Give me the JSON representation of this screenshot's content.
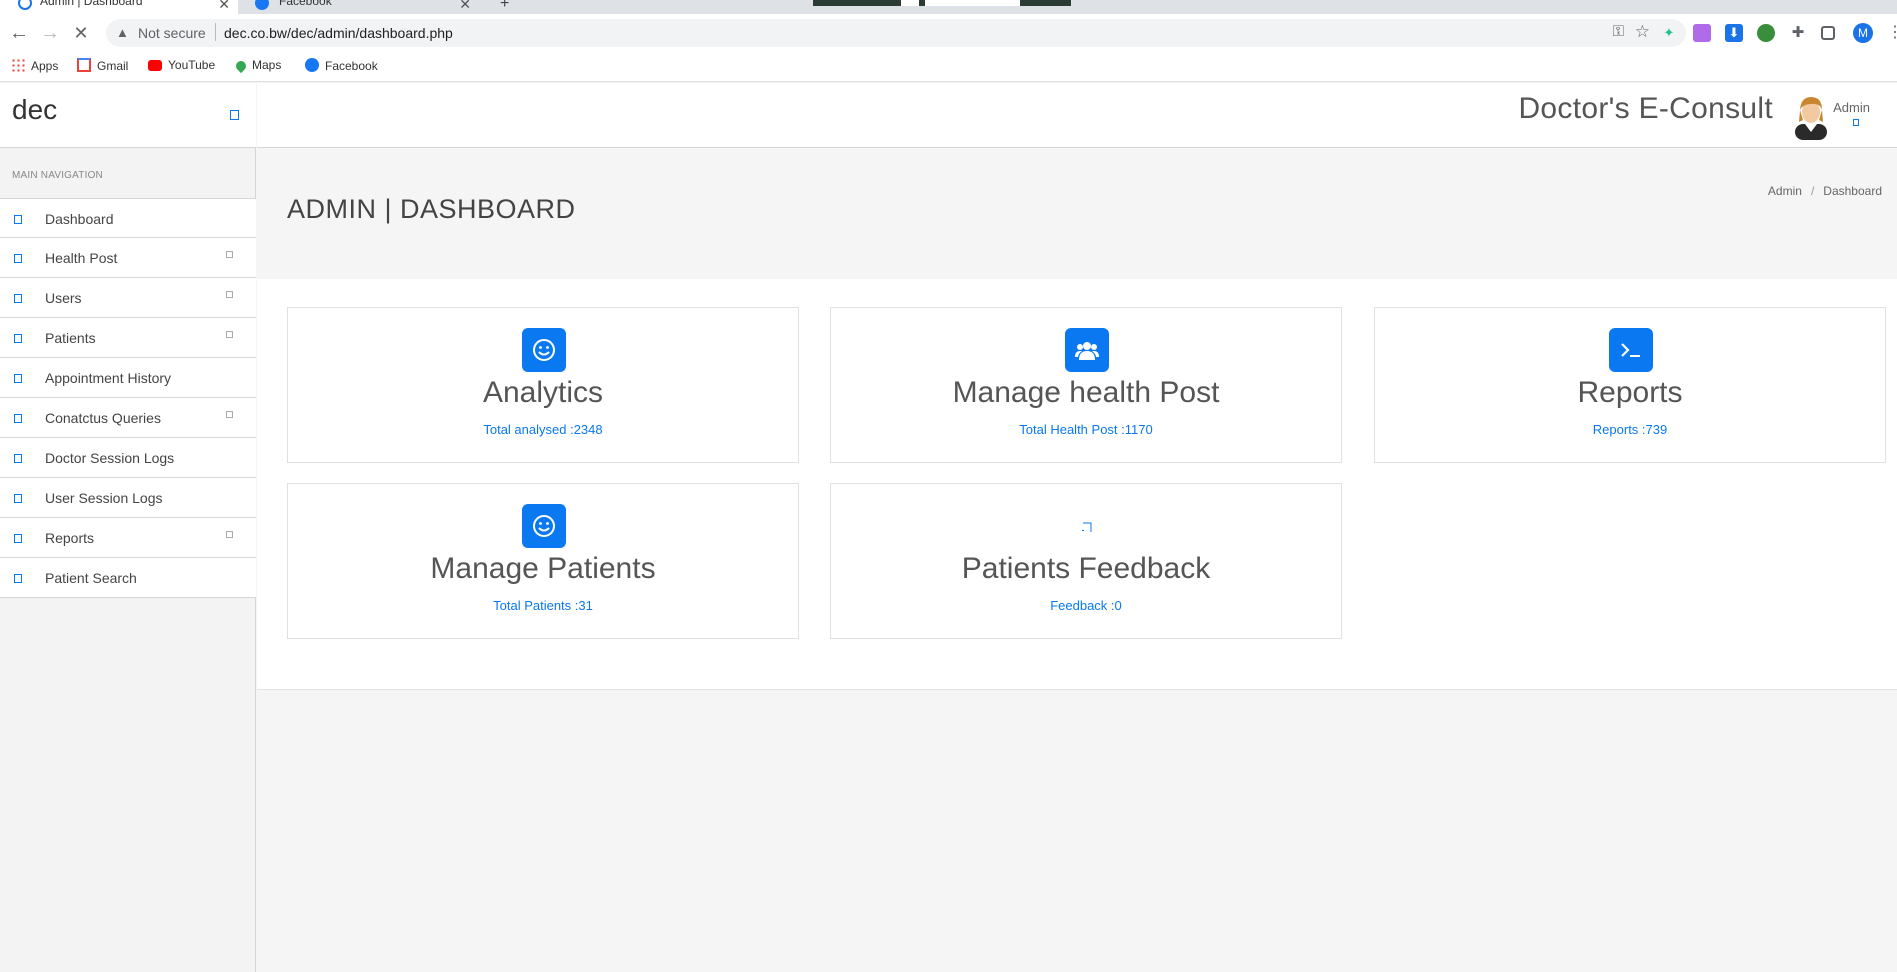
{
  "browser": {
    "tabs": [
      {
        "label": "Admin | Dashboard",
        "active": true
      },
      {
        "label": "Facebook",
        "active": false
      }
    ],
    "address": {
      "security_label": "Not secure",
      "url": "dec.co.bw/dec/admin/dashboard.php"
    },
    "bookmarks": [
      {
        "label": "Apps",
        "icon": "apps-grid-icon"
      },
      {
        "label": "Gmail",
        "icon": "gmail-icon"
      },
      {
        "label": "YouTube",
        "icon": "youtube-icon"
      },
      {
        "label": "Maps",
        "icon": "maps-icon"
      },
      {
        "label": "Facebook",
        "icon": "facebook-icon"
      }
    ],
    "profile_initial": "M"
  },
  "sidebar": {
    "brand": "dec",
    "nav_heading": "MAIN NAVIGATION",
    "items": [
      {
        "label": "Dashboard",
        "has_submenu": false
      },
      {
        "label": "Health Post",
        "has_submenu": true
      },
      {
        "label": "Users",
        "has_submenu": true
      },
      {
        "label": "Patients",
        "has_submenu": true
      },
      {
        "label": "Appointment History",
        "has_submenu": false
      },
      {
        "label": "Conatctus Queries",
        "has_submenu": true
      },
      {
        "label": "Doctor Session Logs",
        "has_submenu": false
      },
      {
        "label": "User Session Logs",
        "has_submenu": false
      },
      {
        "label": "Reports",
        "has_submenu": true
      },
      {
        "label": "Patient Search",
        "has_submenu": false
      }
    ]
  },
  "header": {
    "app_title": "Doctor's E-Consult",
    "user_name": "Admin"
  },
  "page": {
    "title": "ADMIN | DASHBOARD",
    "breadcrumb": [
      "Admin",
      "Dashboard"
    ]
  },
  "cards": [
    {
      "title": "Analytics",
      "stat": "Total analysed :2348",
      "icon": "smile-icon"
    },
    {
      "title": "Manage health Post",
      "stat": "Total Health Post :1170",
      "icon": "users-group-icon"
    },
    {
      "title": "Reports",
      "stat": "Reports :739",
      "icon": "terminal-icon"
    },
    {
      "title": "Manage Patients",
      "stat": "Total Patients :31",
      "icon": "smile-icon"
    },
    {
      "title": "Patients Feedback",
      "stat": "Feedback :0",
      "icon": "broken-image-icon"
    }
  ],
  "colors": {
    "accent": "#0a78f0",
    "sidebar_bg": "#f3f3f3"
  }
}
